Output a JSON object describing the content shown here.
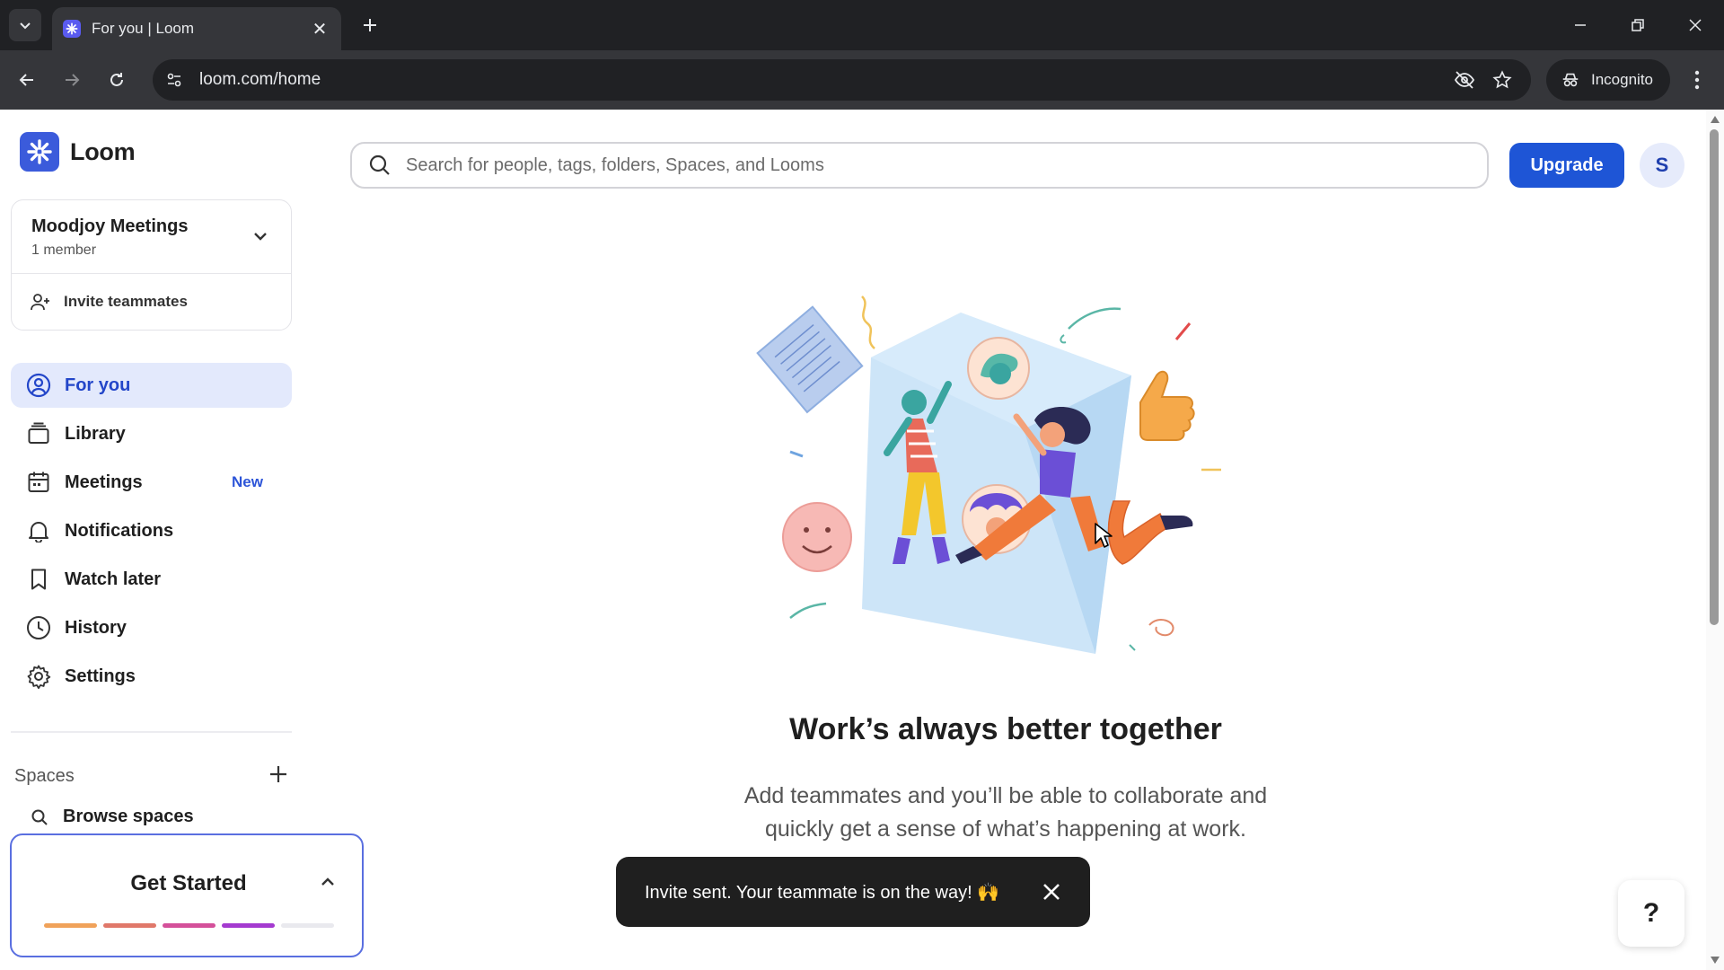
{
  "browser": {
    "tab_title": "For you | Loom",
    "url": "loom.com/home",
    "incognito_label": "Incognito"
  },
  "app": {
    "name": "Loom",
    "brand_color": "#3b5bdb"
  },
  "workspace": {
    "name": "Moodjoy Meetings",
    "members": "1 member",
    "invite_label": "Invite teammates"
  },
  "nav": {
    "items": [
      {
        "label": "For you",
        "icon": "user-circle-icon",
        "active": true
      },
      {
        "label": "Library",
        "icon": "library-icon"
      },
      {
        "label": "Meetings",
        "icon": "calendar-icon",
        "badge": "New"
      },
      {
        "label": "Notifications",
        "icon": "bell-icon"
      },
      {
        "label": "Watch later",
        "icon": "bookmark-icon"
      },
      {
        "label": "History",
        "icon": "clock-icon"
      },
      {
        "label": "Settings",
        "icon": "gear-icon"
      }
    ]
  },
  "spaces": {
    "label": "Spaces",
    "browse_label": "Browse spaces"
  },
  "get_started": {
    "title": "Get Started",
    "progress_colors": [
      "#f0a25a",
      "#e0786a",
      "#d4509a",
      "#a43ad0",
      "#e9e9ee"
    ]
  },
  "search": {
    "placeholder": "Search for people, tags, folders, Spaces, and Looms"
  },
  "header": {
    "upgrade_label": "Upgrade",
    "avatar_initial": "S"
  },
  "main": {
    "headline": "Work’s always better together",
    "subtext_line1": "Add teammates and you’ll be able to collaborate and",
    "subtext_line2": "quickly get a sense of what’s happening at work."
  },
  "toast": {
    "message": "Invite sent. Your teammate is on the way! 🙌"
  },
  "help": {
    "label": "?"
  }
}
